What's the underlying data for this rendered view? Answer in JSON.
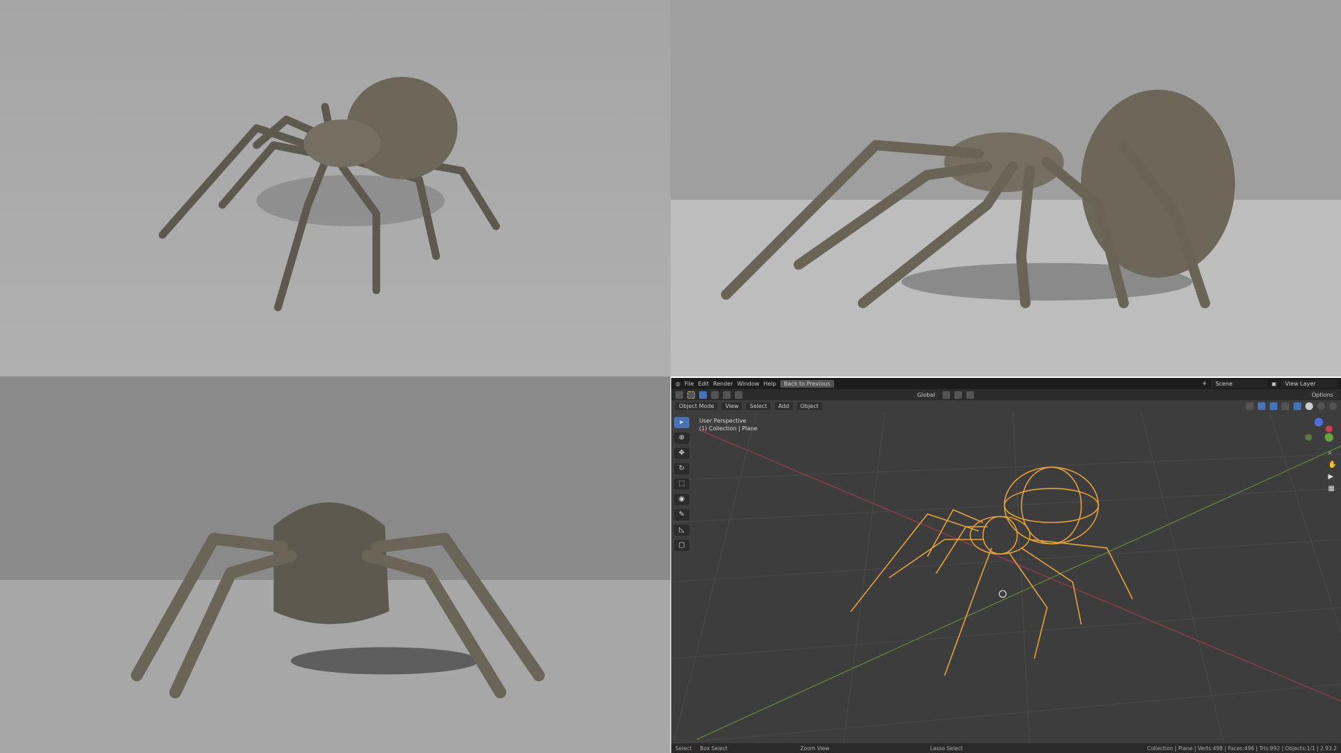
{
  "blender": {
    "menu": [
      "File",
      "Edit",
      "Render",
      "Window",
      "Help"
    ],
    "back_button": "Back to Previous",
    "scene": "Scene",
    "view_layer": "View Layer",
    "transform_orientation": "Global",
    "options": "Options",
    "mode": "Object Mode",
    "header_menu": [
      "View",
      "Select",
      "Add",
      "Object"
    ],
    "viewport_title": "User Perspective",
    "viewport_sub": "(1) Collection | Plane",
    "status_left": [
      "Select",
      "Box Select",
      "Zoom View",
      "Lasso Select"
    ],
    "status_right": "Collection | Plane | Verts:498 | Faces:496 | Tris:992 | Objects:1/1 | 2.93.2"
  },
  "colors": {
    "wire": "#e8a33a",
    "accent": "#4772b3",
    "spider": "#6b6558"
  }
}
